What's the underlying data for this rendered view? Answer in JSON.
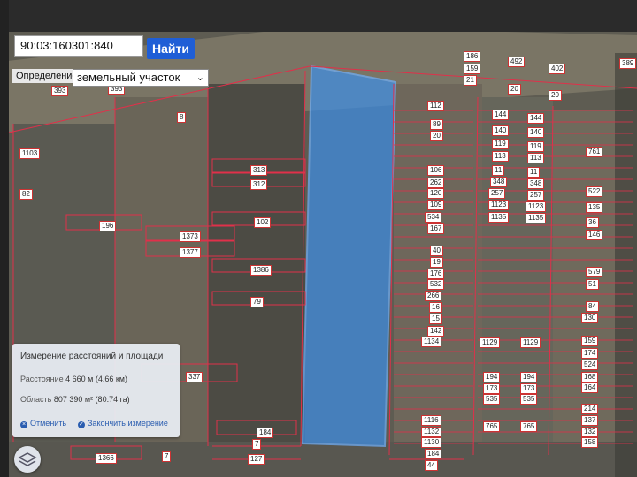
{
  "search": {
    "value": "90:03:160301:840",
    "button_label": "Найти"
  },
  "definition": {
    "label": "Определение",
    "selected": "земельный участок"
  },
  "measure_panel": {
    "title": "Измерение расстояний и площади",
    "distance_label": "Расстояние",
    "distance_value": "4 660 м (4.66 км)",
    "area_label": "Область",
    "area_value": "807 390 м² (80.74 га)",
    "cancel_label": "Отменить",
    "finish_label": "Закончить измерение"
  },
  "icons": {
    "layers": "layers-icon",
    "cancel": "close-circle-icon",
    "finish": "check-circle-icon"
  },
  "colors": {
    "plot_border": "#e0304a",
    "selection": "#3d8fe8",
    "button": "#1f5ed6"
  },
  "plot_labels": [
    "393",
    "393",
    "8",
    "1103",
    "82",
    "196",
    "1373",
    "1377",
    "313",
    "312",
    "102",
    "1386",
    "79",
    "337",
    "184",
    "7",
    "1366",
    "7",
    "127",
    "186",
    "159",
    "21",
    "492",
    "402",
    "20",
    "20",
    "389",
    "112",
    "89",
    "20",
    "106",
    "262",
    "120",
    "109",
    "534",
    "167",
    "40",
    "19",
    "176",
    "532",
    "266",
    "16",
    "15",
    "142",
    "1134",
    "1116",
    "1132",
    "1130",
    "184",
    "44",
    "144",
    "144",
    "140",
    "140",
    "119",
    "119",
    "113",
    "113",
    "11",
    "11",
    "348",
    "348",
    "257",
    "257",
    "1123",
    "1123",
    "1135",
    "1135",
    "1129",
    "1129",
    "194",
    "194",
    "173",
    "173",
    "535",
    "535",
    "765",
    "765",
    "761",
    "522",
    "135",
    "36",
    "146",
    "579",
    "51",
    "84",
    "130",
    "159",
    "174",
    "524",
    "168",
    "164",
    "214",
    "137",
    "132",
    "158"
  ]
}
